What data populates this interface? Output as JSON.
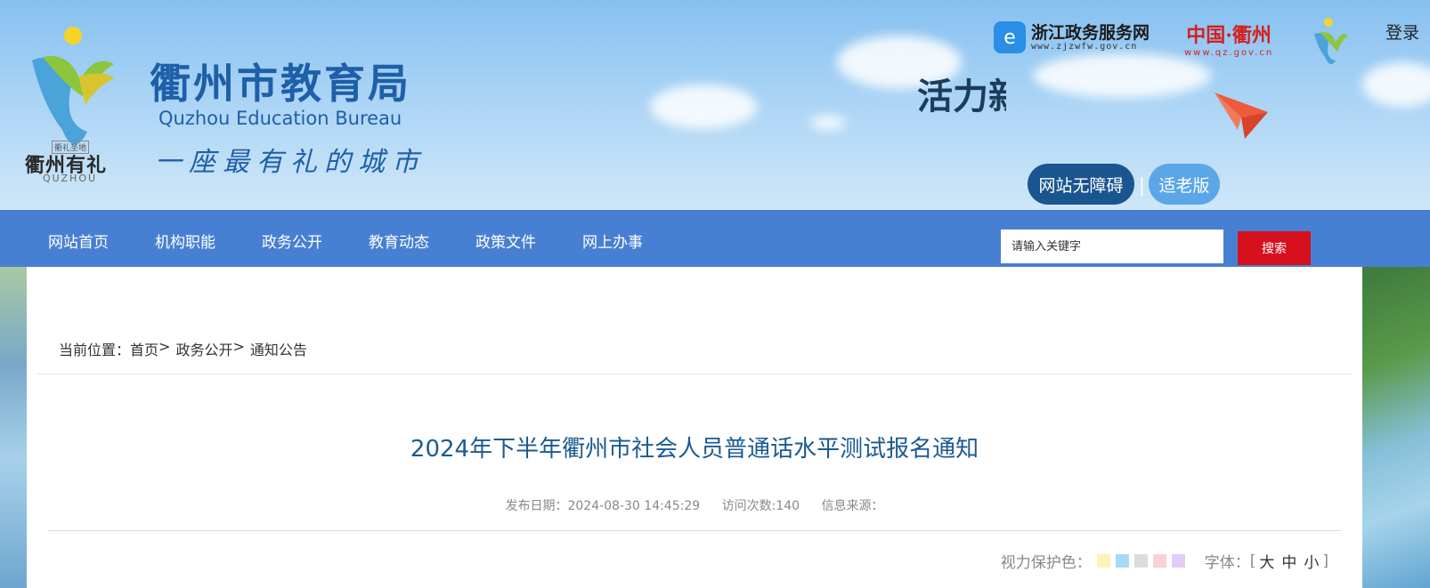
{
  "header": {
    "logo": {
      "caption_top": "衢礼圣地",
      "text": "衢州有礼",
      "sub": "QUZHOU"
    },
    "title": "衢州市教育局",
    "title_en": "Quzhou Education Bureau",
    "slogan": "一座最有礼的城市",
    "banner_text": "活力新",
    "zj_link": {
      "name": "浙江政务服务网",
      "url": "www.zjzwfw.gov.cn",
      "icon": "e-globe-icon"
    },
    "qz_link": {
      "name": "中国·衢州",
      "url": "www.qz.gov.cn"
    },
    "login": "登录",
    "accessibility": {
      "barrier_free": "网站无障碍",
      "separator": "|",
      "elder": "适老版"
    }
  },
  "nav": {
    "items": [
      "网站首页",
      "机构职能",
      "政务公开",
      "教育动态",
      "政策文件",
      "网上办事"
    ]
  },
  "search": {
    "placeholder": "请输入关键字",
    "button": "搜索"
  },
  "breadcrumb": {
    "label": "当前位置：",
    "items": [
      "首页",
      "政务公开",
      "通知公告"
    ],
    "separator": ">"
  },
  "article": {
    "title": "2024年下半年衢州市社会人员普通话水平测试报名通知",
    "publish_label": "发布日期：",
    "publish_date": "2024-08-30 14:45:29",
    "visits_label": "访问次数:",
    "visits": "140",
    "source_label": "信息来源："
  },
  "tools": {
    "eye_label": "视力保护色：",
    "colors": [
      "#fbf3b7",
      "#a5dcf5",
      "#dcdcdc",
      "#f9d1d9",
      "#e3ccf5"
    ],
    "font_label": "字体：",
    "bracket_open": "[",
    "bracket_close": "]",
    "font_sizes": [
      "大",
      "中",
      "小"
    ]
  },
  "colors": {
    "nav_bg": "#4780d2",
    "title": "#1b5a91",
    "search_btn": "#d6101c"
  }
}
